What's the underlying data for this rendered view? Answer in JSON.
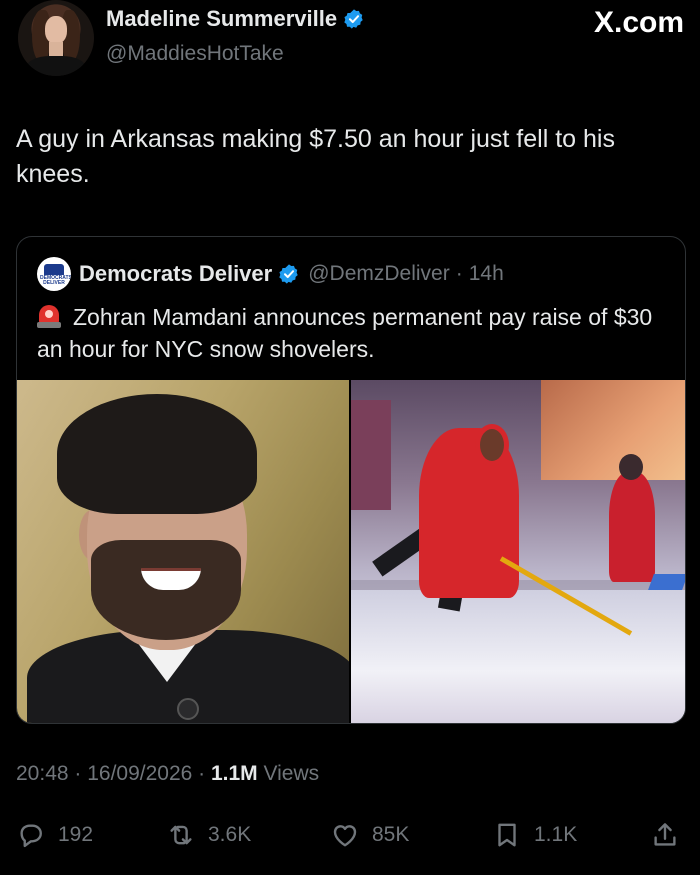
{
  "author": {
    "name": "Madeline Summerville",
    "handle": "@MaddiesHotTake",
    "verified_color": "#1d9bf0"
  },
  "brand": "X.com",
  "tweet": {
    "text": "A guy in Arkansas making $7.50 an hour just fell to his knees.",
    "timestamp": "20:48 · 16/09/2026 · ",
    "views_count": "1.1M",
    "views_label": " Views"
  },
  "quote": {
    "name": "Democrats Deliver",
    "handle": "@DemzDeliver",
    "separator": "·",
    "age": "14h",
    "logo_text": "DEMOCRATS DELIVER",
    "emoji_icon": "police-light-icon",
    "text": "Zohran Mamdani announces permanent pay raise of $30 an hour for NYC snow shovelers."
  },
  "actions": {
    "replies": "192",
    "reposts": "3.6K",
    "likes": "85K",
    "bookmarks": "1.1K"
  },
  "colors": {
    "background": "#000000",
    "text": "#e7e9ea",
    "muted": "#71767b",
    "border": "#2f3336"
  }
}
